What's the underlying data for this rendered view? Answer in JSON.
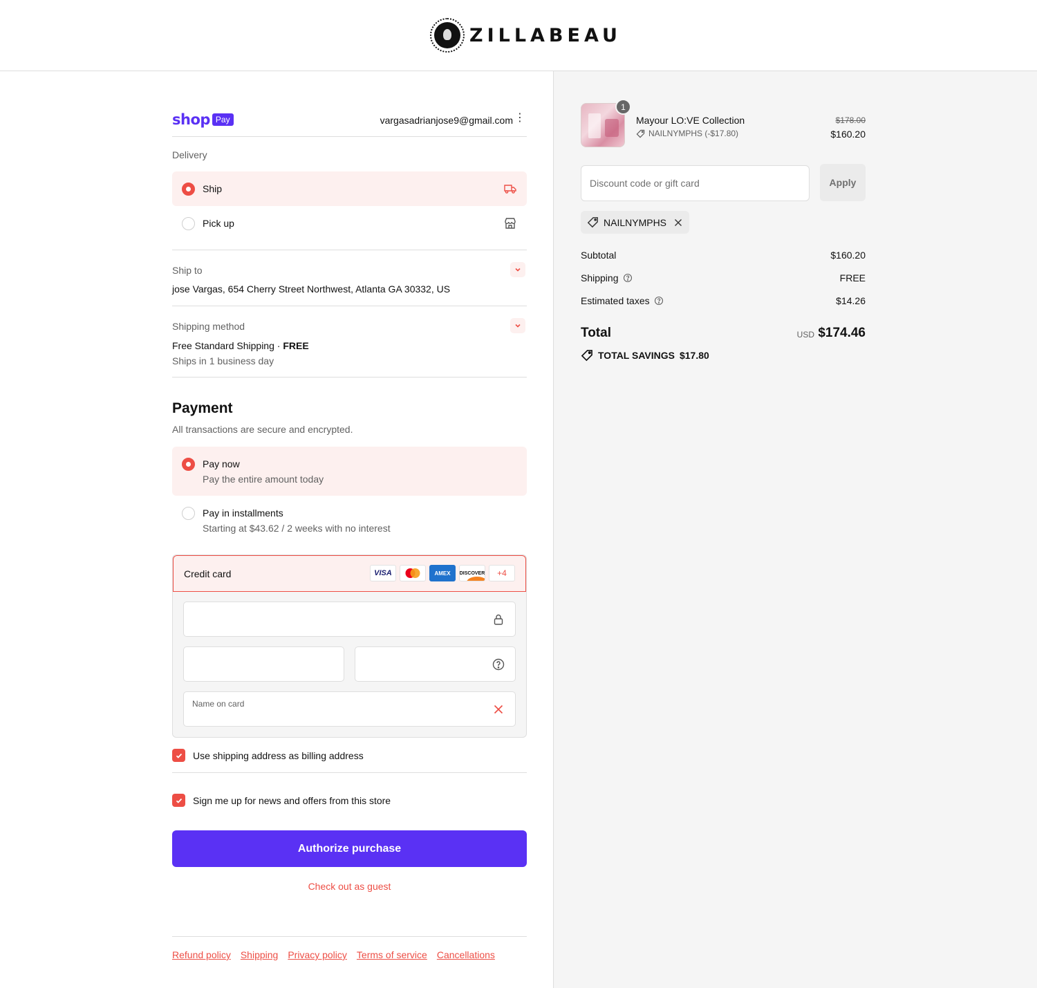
{
  "brand": {
    "name": "ZILLABEAU"
  },
  "shoppay": {
    "word": "shop",
    "badge": "Pay",
    "email": "vargasadrianjose9@gmail.com",
    "menu_glyph": "⋮"
  },
  "delivery": {
    "label": "Delivery",
    "options": [
      {
        "label": "Ship",
        "selected": true,
        "icon": "truck-icon"
      },
      {
        "label": "Pick up",
        "selected": false,
        "icon": "store-icon"
      }
    ]
  },
  "ship_to": {
    "label": "Ship to",
    "value": "jose Vargas, 654 Cherry Street Northwest, Atlanta GA 30332, US"
  },
  "shipping_method": {
    "label": "Shipping method",
    "name": "Free Standard Shipping",
    "dot": " · ",
    "price": "FREE",
    "eta": "Ships in 1 business day"
  },
  "payment": {
    "title": "Payment",
    "subtitle": "All transactions are secure and encrypted.",
    "options": [
      {
        "title": "Pay now",
        "desc": "Pay the entire amount today",
        "selected": true
      },
      {
        "title": "Pay in installments",
        "desc": "Starting at $43.62 / 2 weeks with no interest",
        "selected": false
      }
    ],
    "credit_card": {
      "title": "Credit card",
      "cards": {
        "visa": "VISA",
        "amex": "AMEX",
        "discover": "DISCOVER",
        "more": "+4"
      },
      "name_placeholder": "Name on card"
    }
  },
  "checkboxes": {
    "billing": "Use shipping address as billing address",
    "news": "Sign me up for news and offers from this store"
  },
  "actions": {
    "authorize": "Authorize purchase",
    "guest": "Check out as guest"
  },
  "footer": {
    "links": [
      "Refund policy",
      "Shipping",
      "Privacy policy",
      "Terms of service",
      "Cancellations"
    ]
  },
  "summary": {
    "product": {
      "qty": "1",
      "name": "Mayour LO:VE Collection",
      "discount": "NAILNYMPHS (-$17.80)",
      "price_old": "$178.00",
      "price_new": "$160.20"
    },
    "discount_placeholder": "Discount code or gift card",
    "apply_label": "Apply",
    "applied_code": "NAILNYMPHS",
    "subtotal_label": "Subtotal",
    "subtotal_value": "$160.20",
    "shipping_label": "Shipping",
    "shipping_value": "FREE",
    "taxes_label": "Estimated taxes",
    "taxes_value": "$14.26",
    "total_label": "Total",
    "currency": "USD",
    "total_value": "$174.46",
    "savings_label": "TOTAL SAVINGS",
    "savings_value": "$17.80"
  },
  "colors": {
    "accent": "#ed4e45",
    "shop_purple": "#5a31f4",
    "selected_bg": "#fdf0ef",
    "summary_bg": "#f5f5f5"
  }
}
